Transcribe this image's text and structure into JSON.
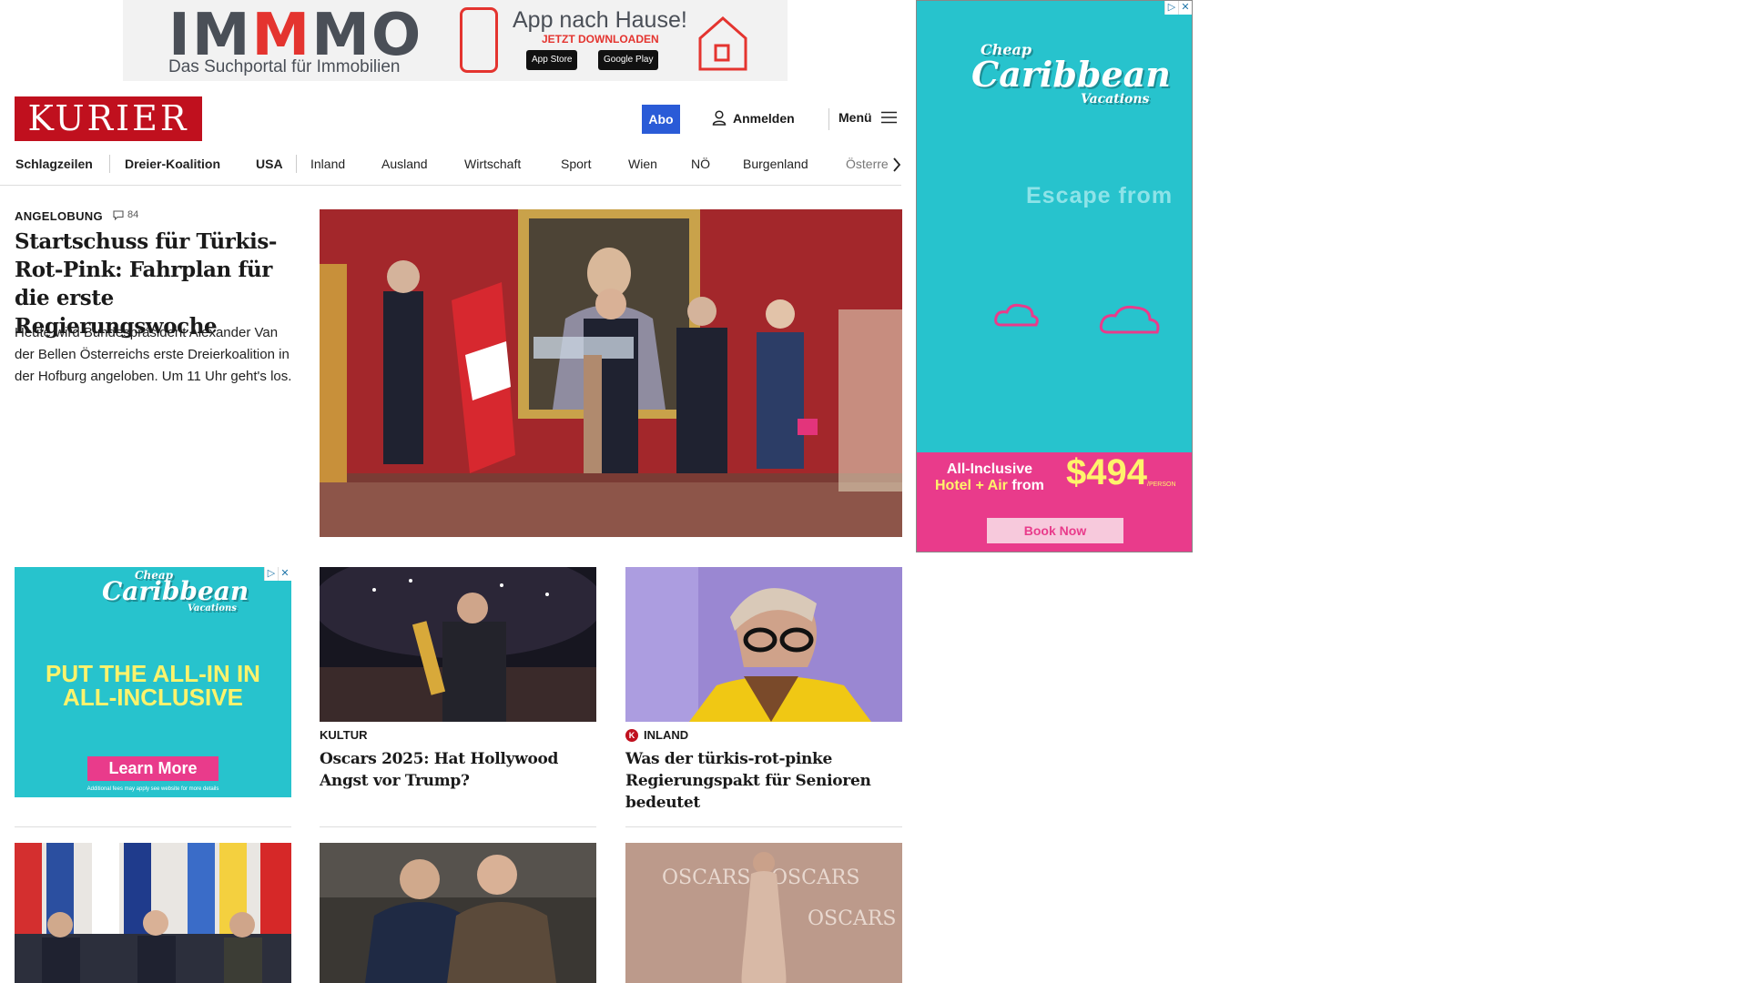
{
  "top_banner": {
    "logo_prefix": "IM",
    "logo_highlight": "M",
    "logo_suffix": "MO",
    "tagline": "Das Suchportal für Immobilien",
    "app_title": "App nach Hause!",
    "app_sub": "JETZT DOWNLOADEN",
    "store_apple": "App Store",
    "store_google": "Google Play"
  },
  "header": {
    "logo_text": "KURIER",
    "abo_label": "Abo",
    "login_label": "Anmelden",
    "menu_label": "Menü"
  },
  "nav": {
    "items": [
      "Schlagzeilen",
      "Dreier-Koalition",
      "USA",
      "Inland",
      "Ausland",
      "Wirtschaft",
      "Sport",
      "Wien",
      "NÖ",
      "Burgenland",
      "Österre"
    ]
  },
  "lead": {
    "category": "ANGELOBUNG",
    "comments": "84",
    "title": "Startschuss für Türkis-Rot-Pink: Fahrplan für die erste Regierungswoche",
    "teaser": "Heute wird Bundespräsident Alexander Van der Bellen Österreichs erste Dreierkoalition in der Hofburg angeloben. Um 11 Uhr geht's los."
  },
  "right_ad": {
    "brand_top": "Cheap",
    "brand_main": "Caribbean",
    "brand_sub": "Vacations",
    "escape": "Escape  from",
    "all_inclusive": "All-Inclusive",
    "hotel_air": "Hotel + Air",
    "from": "from",
    "price": "$494",
    "per_person": "/PERSON",
    "cta": "Book Now"
  },
  "small_ad": {
    "brand_top": "Cheap",
    "brand_main": "Caribbean",
    "brand_sub": "Vacations",
    "headline_line1": "PUT THE ALL-IN IN",
    "headline_line2": "ALL-INCLUSIVE",
    "cta": "Learn More",
    "fine_print": "Additional fees may apply see website for more details"
  },
  "cards": [
    {
      "category": "KULTUR",
      "title": "Oscars 2025: Hat Hollywood Angst vor Trump?"
    },
    {
      "category": "INLAND",
      "badge": "K",
      "title": "Was der türkis-rot-pinke Regierungspakt für Senioren bedeutet"
    }
  ],
  "colors": {
    "kurier_red": "#c0101e",
    "abo_blue": "#2a5bd7",
    "ad_teal": "#27c3cd",
    "ad_pink": "#e93b8b",
    "ad_yellow": "#fff36b"
  }
}
